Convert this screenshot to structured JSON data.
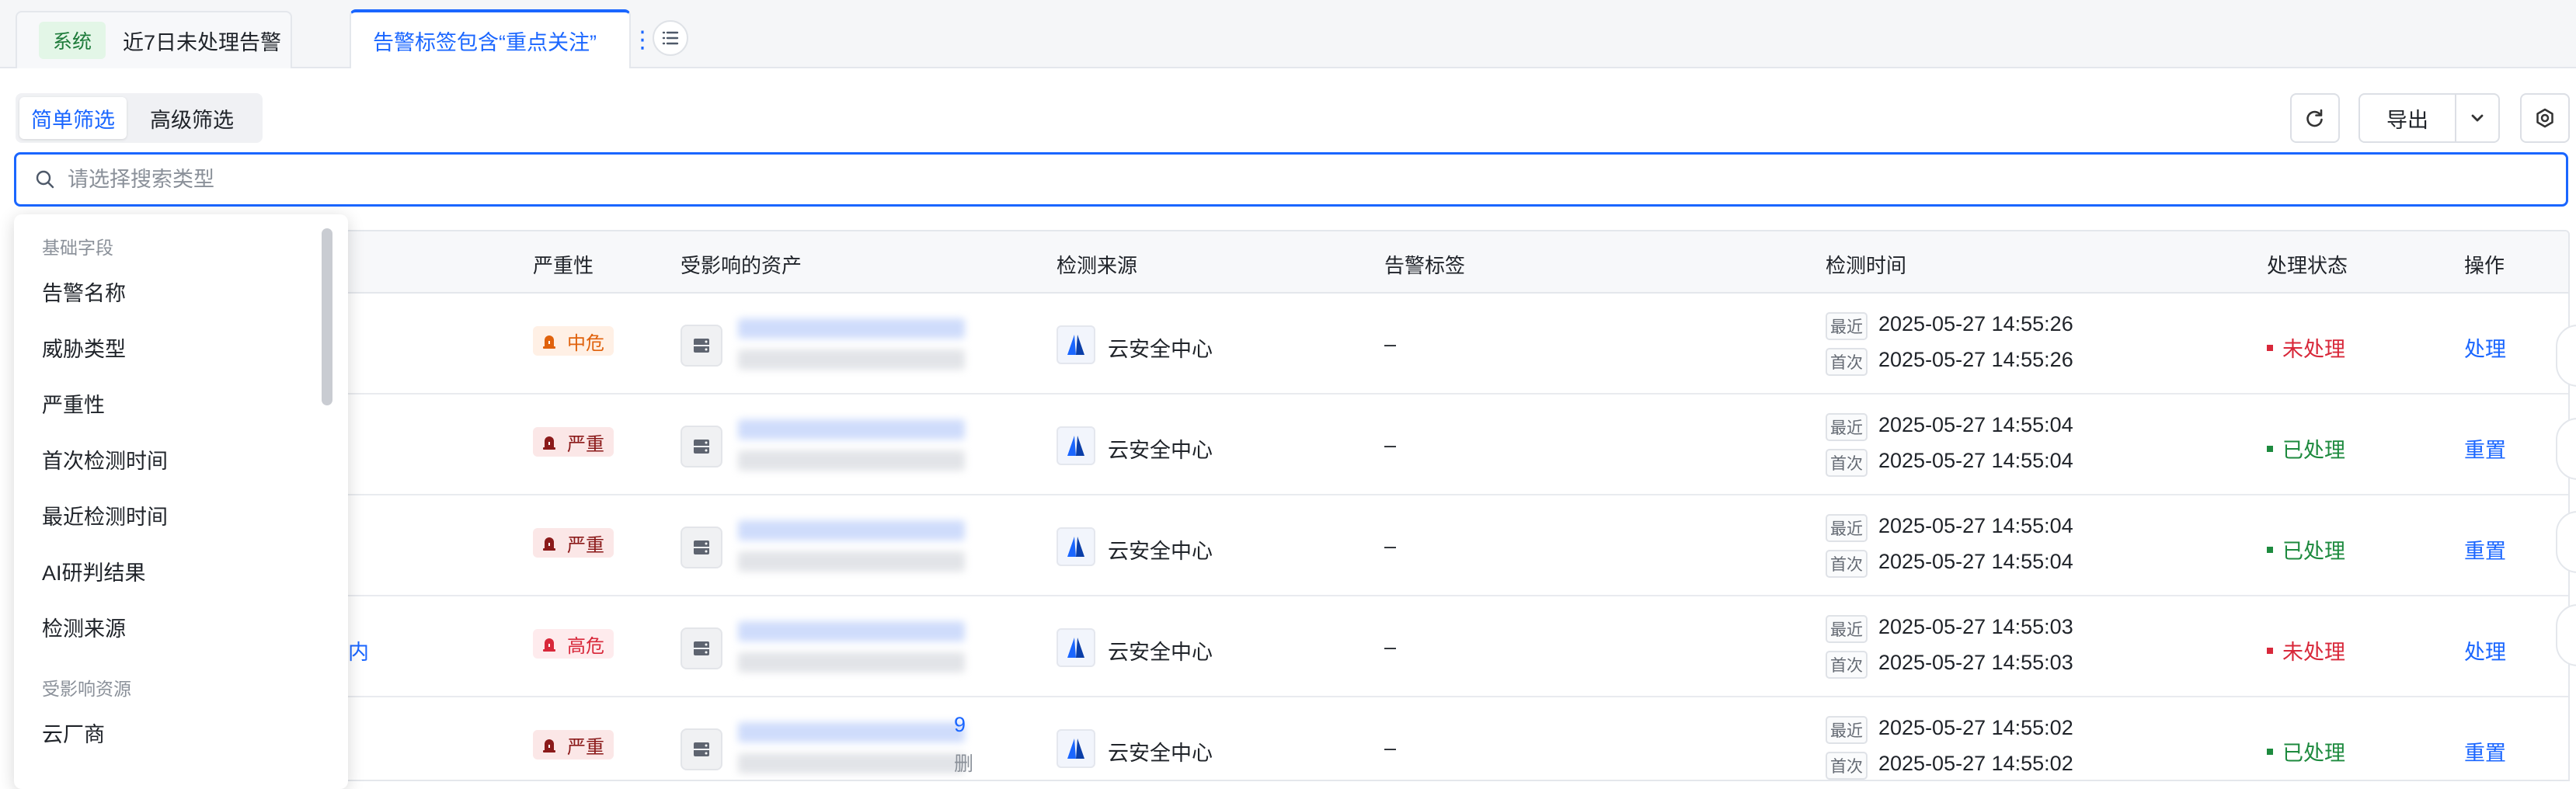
{
  "tabs": [
    {
      "badge": "系统",
      "label": "近7日未处理告警"
    },
    {
      "label": "告警标签包含“重点关注”",
      "more": "⋮"
    }
  ],
  "filter": {
    "simple": "简单筛选",
    "advanced": "高级筛选"
  },
  "toolbar": {
    "export": "导出"
  },
  "search": {
    "placeholder": "请选择搜索类型"
  },
  "columns": {
    "severity": "严重性",
    "asset": "受影响的资产",
    "source": "检测来源",
    "tags": "告警标签",
    "time": "检测时间",
    "status": "处理状态",
    "action": "操作"
  },
  "time_labels": {
    "latest": "最近",
    "first": "首次"
  },
  "colors": {
    "accent": "#1a66ff",
    "critical": "#8b1a1a",
    "high": "#d8283a",
    "medium": "#e0620d",
    "unhandled": "#d8283a",
    "handled": "#1d8a3e"
  },
  "rows": [
    {
      "severity": "中危",
      "sev_level": "medium",
      "source": "云安全中心",
      "tags": "–",
      "latest": "2025-05-27 14:55:26",
      "first": "2025-05-27 14:55:26",
      "status": "未处理",
      "action": "处理"
    },
    {
      "severity": "严重",
      "sev_level": "critical",
      "source": "云安全中心",
      "tags": "–",
      "latest": "2025-05-27 14:55:04",
      "first": "2025-05-27 14:55:04",
      "status": "已处理",
      "action": "重置"
    },
    {
      "severity": "严重",
      "sev_level": "critical",
      "source": "云安全中心",
      "tags": "–",
      "latest": "2025-05-27 14:55:04",
      "first": "2025-05-27 14:55:04",
      "status": "已处理",
      "action": "重置"
    },
    {
      "severity": "高危",
      "sev_level": "high",
      "name_fragment": "内",
      "source": "云安全中心",
      "tags": "–",
      "latest": "2025-05-27 14:55:03",
      "first": "2025-05-27 14:55:03",
      "status": "未处理",
      "action": "处理"
    },
    {
      "severity": "严重",
      "sev_level": "critical",
      "asset_fragment_1": "9",
      "asset_fragment_2": "删",
      "source": "云安全中心",
      "tags": "–",
      "latest": "2025-05-27 14:55:02",
      "first": "2025-05-27 14:55:02",
      "status": "已处理",
      "action": "重置"
    }
  ],
  "dropdown": {
    "group1": "基础字段",
    "items1": [
      "告警名称",
      "威胁类型",
      "严重性",
      "首次检测时间",
      "最近检测时间",
      "AI研判结果",
      "检测来源"
    ],
    "group2": "受影响资源",
    "items2": [
      "云厂商"
    ]
  }
}
